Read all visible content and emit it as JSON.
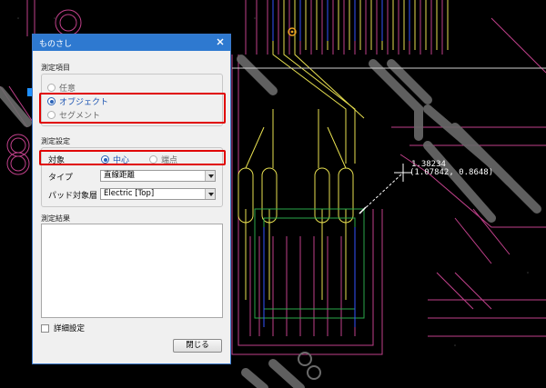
{
  "cad": {
    "measure_value": "1.38234",
    "measure_coords": "(1.07842, 0.8648)"
  },
  "dialog": {
    "title": "ものさし",
    "close_icon": "close-icon",
    "measure_items": {
      "heading": "測定項目",
      "options": [
        "任意",
        "オブジェクト",
        "セグメント"
      ],
      "selected": "オブジェクト"
    },
    "measure_settings": {
      "heading": "測定設定",
      "target_label": "対象",
      "target_options": [
        "中心",
        "端点"
      ],
      "target_selected": "中心",
      "type_label": "タイプ",
      "type_value": "直線距離",
      "pad_layer_label": "パッド対象層",
      "pad_layer_value": "Electric [Top]"
    },
    "results": {
      "heading": "測定結果"
    },
    "advanced_label": "詳細設定",
    "close_button_label": "閉じる"
  },
  "colors": {
    "titlebar": "#2e79d0",
    "highlight": "#e00000",
    "selected_radio": "#2a63b8"
  }
}
